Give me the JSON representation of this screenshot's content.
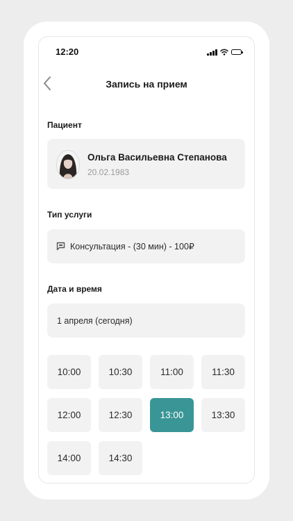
{
  "status_bar": {
    "time": "12:20",
    "icons": [
      "signal-icon",
      "wifi-icon",
      "battery-icon"
    ]
  },
  "header": {
    "title": "Запись на прием",
    "back_icon": "chevron-left-icon"
  },
  "patient": {
    "label": "Пациент",
    "name": "Ольга Васильевна Степанова",
    "dob": "20.02.1983"
  },
  "service": {
    "label": "Тип услуги",
    "icon": "chat-icon",
    "text": "Консультация - (30 мин) - 100₽"
  },
  "datetime": {
    "label": "Дата и время",
    "date": "1 апреля (сегодня)",
    "slots": [
      "10:00",
      "10:30",
      "11:00",
      "11:30",
      "12:00",
      "12:30",
      "13:00",
      "13:30",
      "14:00",
      "14:30"
    ],
    "selected": "13:00"
  },
  "colors": {
    "accent": "#3a9596",
    "card_bg": "#f2f2f2",
    "muted_text": "#9a9a9a"
  }
}
